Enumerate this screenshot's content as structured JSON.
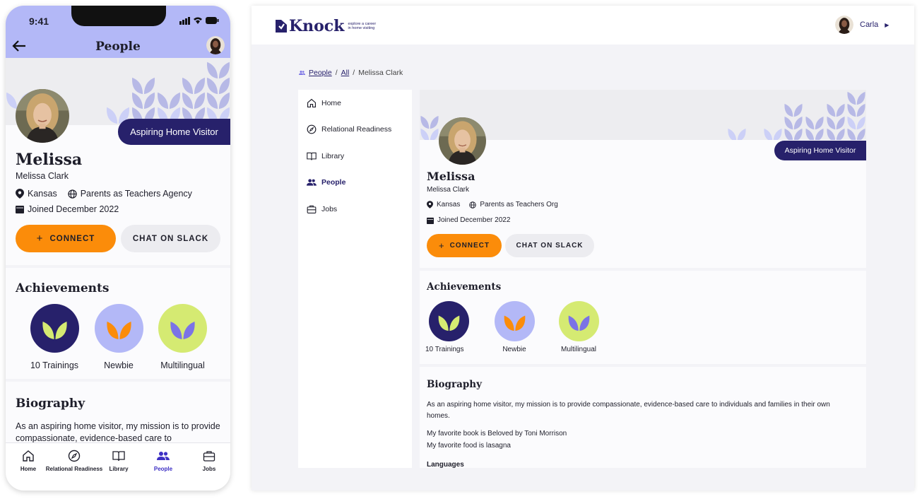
{
  "colors": {
    "navy": "#27216b",
    "orange": "#fb8c0a",
    "lavender": "#b3b8f7",
    "lime": "#d5ea72",
    "leaf_light": "#ccd0f7",
    "leaf_mid": "#b7b9e6"
  },
  "mobile": {
    "status_time": "9:41",
    "title": "People",
    "tag": "Aspiring Home Visitor",
    "first_name": "Melissa",
    "full_name": "Melissa Clark",
    "location": "Kansas",
    "organization": "Parents as Teachers Agency",
    "joined": "Joined December 2022",
    "connect_label": "CONNECT",
    "slack_label": "CHAT ON SLACK",
    "achievements_heading": "Achievements",
    "biography_heading": "Biography",
    "biography_text": "As an aspiring home visitor, my mission is to provide compassionate, evidence-based care to",
    "nav": [
      {
        "label": "Home",
        "icon": "home-icon"
      },
      {
        "label": "Relational Readiness",
        "icon": "compass-icon"
      },
      {
        "label": "Library",
        "icon": "book-icon"
      },
      {
        "label": "People",
        "icon": "people-icon"
      },
      {
        "label": "Jobs",
        "icon": "briefcase-icon"
      }
    ]
  },
  "achievements": [
    {
      "label": "10 Trainings",
      "circle": "#27216b",
      "leaf": "#d5ea72"
    },
    {
      "label": "Newbie",
      "circle": "#b3b8f7",
      "leaf": "#fb8c0a"
    },
    {
      "label": "Multilingual",
      "circle": "#d5ea72",
      "leaf": "#7b73e6"
    }
  ],
  "desktop": {
    "brand": "Knock",
    "brand_tagline_1": "explore a career",
    "brand_tagline_2": "in home visiting",
    "user_name": "Carla",
    "breadcrumb": {
      "people": "People",
      "all": "All",
      "current": "Melissa Clark",
      "sep": "/"
    },
    "sidebar": [
      {
        "label": "Home",
        "icon": "home-icon"
      },
      {
        "label": "Relational Readiness",
        "icon": "compass-icon"
      },
      {
        "label": "Library",
        "icon": "book-icon"
      },
      {
        "label": "People",
        "icon": "people-icon"
      },
      {
        "label": "Jobs",
        "icon": "briefcase-icon"
      }
    ],
    "tag": "Aspiring Home Visitor",
    "first_name": "Melissa",
    "full_name": "Melissa Clark",
    "location": "Kansas",
    "organization": "Parents as Teachers Org",
    "joined": "Joined December 2022",
    "connect_label": "CONNECT",
    "slack_label": "CHAT ON SLACK",
    "achievements_heading": "Achievements",
    "biography_heading": "Biography",
    "biography_text": "As an aspiring home visitor, my mission is to provide compassionate, evidence-based care to individuals and families in their own homes.",
    "favorite_book": "My favorite book is Beloved by Toni Morrison",
    "favorite_food": "My favorite food is lasagna",
    "languages_heading": "Languages"
  }
}
